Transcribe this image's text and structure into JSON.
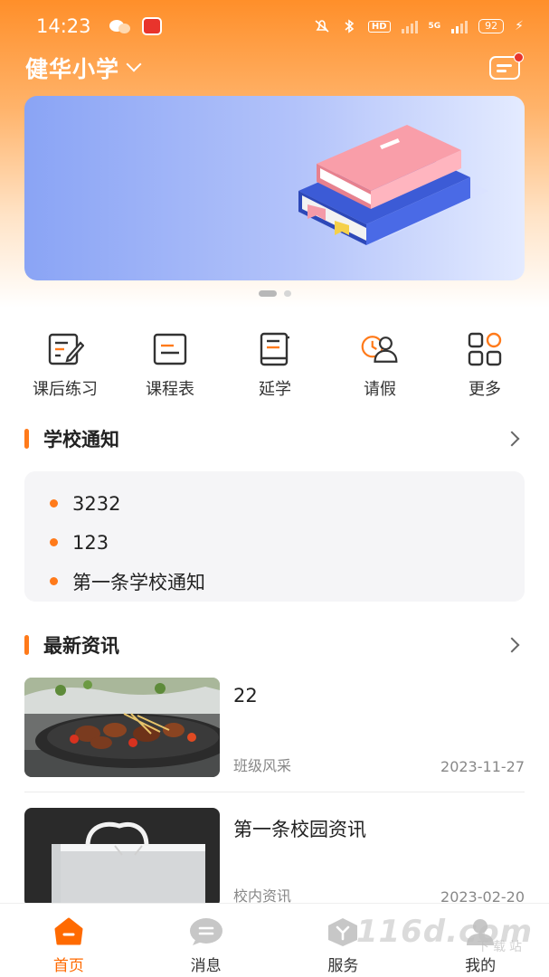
{
  "status_bar": {
    "time": "14:23",
    "hd_label": "HD",
    "net_label": "5G",
    "battery": "92"
  },
  "header": {
    "school_name": "健华小学",
    "icons": [
      "chevron-down-icon",
      "message-icon"
    ]
  },
  "banner": {
    "slides": 2,
    "active_slide": 1
  },
  "quick_actions": [
    {
      "label": "课后练习",
      "icon": "homework-icon"
    },
    {
      "label": "课程表",
      "icon": "schedule-icon"
    },
    {
      "label": "延学",
      "icon": "book-icon"
    },
    {
      "label": "请假",
      "icon": "leave-icon"
    },
    {
      "label": "更多",
      "icon": "more-grid-icon"
    }
  ],
  "school_notice": {
    "title": "学校通知",
    "items": [
      "3232",
      "123",
      "第一条学校通知"
    ]
  },
  "latest_news": {
    "title": "最新资讯",
    "items": [
      {
        "title": "22",
        "category": "班级风采",
        "date": "2023-11-27"
      },
      {
        "title": "第一条校园资讯",
        "category": "校内资讯",
        "date": "2023-02-20"
      }
    ]
  },
  "tabbar": {
    "tabs": [
      {
        "label": "首页",
        "icon": "home-icon",
        "active": true
      },
      {
        "label": "消息",
        "icon": "message-tab-icon",
        "active": false
      },
      {
        "label": "服务",
        "icon": "service-icon",
        "active": false
      },
      {
        "label": "我的",
        "icon": "profile-icon",
        "active": false
      }
    ]
  },
  "watermark": {
    "text": "116d.com",
    "sub": "下载站"
  },
  "colors": {
    "accent": "#ff7a1a",
    "active_tab": "#ff6a00",
    "header_gradient_top": "#ff8f2a"
  }
}
